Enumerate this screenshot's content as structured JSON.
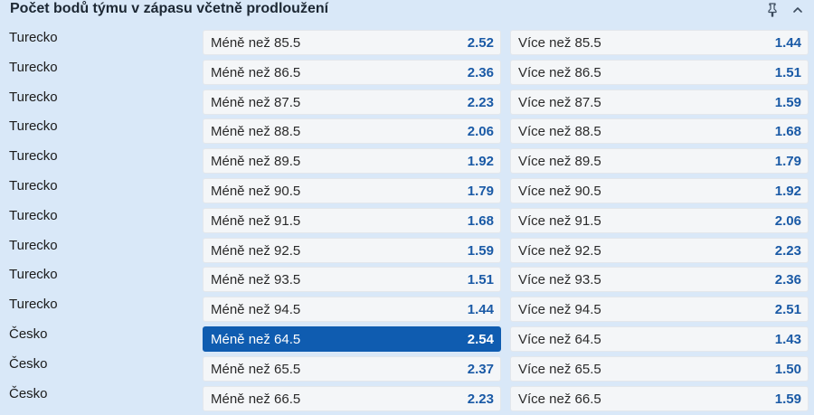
{
  "header": {
    "title": "Počet bodů týmu v zápasu včetně prodloužení",
    "pin_icon": "pin-icon",
    "collapse_icon": "chevron-up-icon"
  },
  "colors": {
    "background": "#d9e8f8",
    "odds_value": "#1a5aa6",
    "selected": "#0f5cb0"
  },
  "rows": [
    {
      "team": "Turecko",
      "under": {
        "label": "Méně než 85.5",
        "odds": "2.52"
      },
      "over": {
        "label": "Více než 85.5",
        "odds": "1.44"
      }
    },
    {
      "team": "Turecko",
      "under": {
        "label": "Méně než 86.5",
        "odds": "2.36"
      },
      "over": {
        "label": "Více než 86.5",
        "odds": "1.51"
      }
    },
    {
      "team": "Turecko",
      "under": {
        "label": "Méně než 87.5",
        "odds": "2.23"
      },
      "over": {
        "label": "Více než 87.5",
        "odds": "1.59"
      }
    },
    {
      "team": "Turecko",
      "under": {
        "label": "Méně než 88.5",
        "odds": "2.06"
      },
      "over": {
        "label": "Více než 88.5",
        "odds": "1.68"
      }
    },
    {
      "team": "Turecko",
      "under": {
        "label": "Méně než 89.5",
        "odds": "1.92"
      },
      "over": {
        "label": "Více než 89.5",
        "odds": "1.79"
      }
    },
    {
      "team": "Turecko",
      "under": {
        "label": "Méně než 90.5",
        "odds": "1.79"
      },
      "over": {
        "label": "Více než 90.5",
        "odds": "1.92"
      }
    },
    {
      "team": "Turecko",
      "under": {
        "label": "Méně než 91.5",
        "odds": "1.68"
      },
      "over": {
        "label": "Více než 91.5",
        "odds": "2.06"
      }
    },
    {
      "team": "Turecko",
      "under": {
        "label": "Méně než 92.5",
        "odds": "1.59"
      },
      "over": {
        "label": "Více než 92.5",
        "odds": "2.23"
      }
    },
    {
      "team": "Turecko",
      "under": {
        "label": "Méně než 93.5",
        "odds": "1.51"
      },
      "over": {
        "label": "Více než 93.5",
        "odds": "2.36"
      }
    },
    {
      "team": "Turecko",
      "under": {
        "label": "Méně než 94.5",
        "odds": "1.44"
      },
      "over": {
        "label": "Více než 94.5",
        "odds": "2.51"
      }
    },
    {
      "team": "Česko",
      "under": {
        "label": "Méně než 64.5",
        "odds": "2.54",
        "selected": true
      },
      "over": {
        "label": "Více než 64.5",
        "odds": "1.43"
      }
    },
    {
      "team": "Česko",
      "under": {
        "label": "Méně než 65.5",
        "odds": "2.37"
      },
      "over": {
        "label": "Více než 65.5",
        "odds": "1.50"
      }
    },
    {
      "team": "Česko",
      "under": {
        "label": "Méně než 66.5",
        "odds": "2.23"
      },
      "over": {
        "label": "Více než 66.5",
        "odds": "1.59"
      }
    }
  ]
}
